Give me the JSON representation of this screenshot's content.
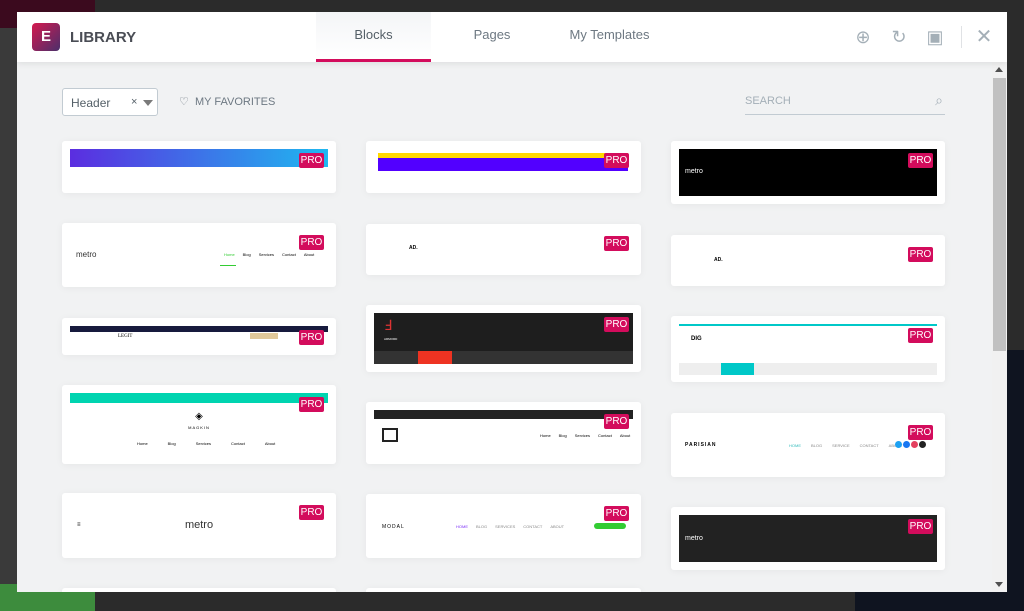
{
  "header": {
    "title": "LIBRARY",
    "logo": "E",
    "tabs": [
      {
        "label": "Blocks",
        "active": true
      },
      {
        "label": "Pages"
      },
      {
        "label": "My Templates"
      }
    ],
    "icons": [
      "upload-icon",
      "sync-icon",
      "save-icon",
      "close-icon"
    ]
  },
  "filters": {
    "category": "Header",
    "favorites": "MY FAVORITES",
    "search_placeholder": "SEARCH"
  },
  "badge": "PRO",
  "colors": {
    "accent": "#d30c5c",
    "pro": "#d30c5c"
  },
  "previews": {
    "metro": "metro",
    "ad": "AD.",
    "legit": "LEGIT",
    "magkin": "MAGKIN",
    "armord": "ARMORD",
    "digit": "DIG",
    "parisian": "PARISIAN",
    "modal": "MODAL",
    "nav": [
      "Home",
      "Blog",
      "Services",
      "Contact",
      "About"
    ],
    "nav2": [
      "Home",
      "Blog",
      "Services",
      "About",
      "Blog",
      "Support",
      "Contact"
    ]
  }
}
